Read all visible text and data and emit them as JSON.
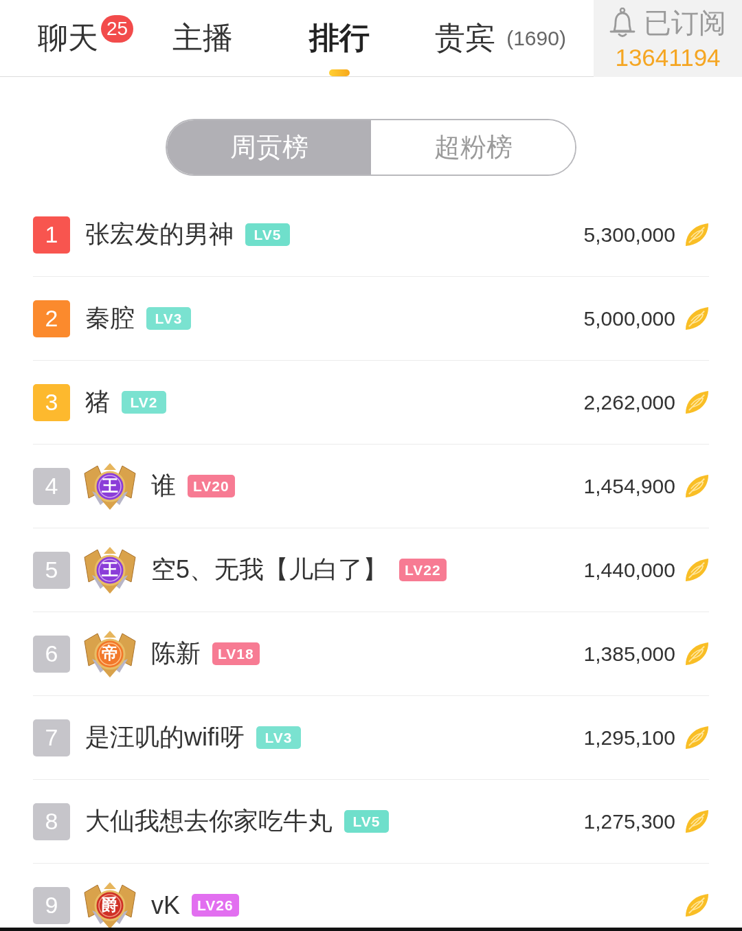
{
  "tabs": [
    {
      "label": "聊天",
      "selected": false,
      "badge": "25"
    },
    {
      "label": "主播",
      "selected": false
    },
    {
      "label": "排行",
      "selected": true
    },
    {
      "label": "贵宾",
      "selected": false,
      "count": "(1690)"
    }
  ],
  "subscribe": {
    "label": "已订阅",
    "count": "13641194"
  },
  "board_tabs": [
    {
      "label": "周贡榜",
      "selected": true
    },
    {
      "label": "超粉榜",
      "selected": false
    }
  ],
  "rows": [
    {
      "rank": {
        "text": "1",
        "color": "#f8554f"
      },
      "name": "张宏发的男神",
      "level": {
        "text": "LV5",
        "color": "#6fdfcb"
      },
      "amount": "5,300,000"
    },
    {
      "rank": {
        "text": "2",
        "color": "#fb8a2d"
      },
      "name": "秦腔",
      "level": {
        "text": "LV3",
        "color": "#7ae2d0"
      },
      "amount": "5,000,000"
    },
    {
      "rank": {
        "text": "3",
        "color": "#fdb92e"
      },
      "name": "猪",
      "level": {
        "text": "LV2",
        "color": "#7ae2d0"
      },
      "amount": "2,262,000"
    },
    {
      "rank": {
        "text": "4",
        "color": "#c6c5ca"
      },
      "emblem": {
        "kind": "violet",
        "label": "王"
      },
      "name": "谁",
      "level": {
        "text": "LV20",
        "color": "#f77b93"
      },
      "amount": "1,454,900"
    },
    {
      "rank": {
        "text": "5",
        "color": "#c6c5ca"
      },
      "emblem": {
        "kind": "violet",
        "label": "王"
      },
      "name": "空5、无我【儿白了】",
      "level": {
        "text": "LV22",
        "color": "#f77b93"
      },
      "amount": "1,440,000"
    },
    {
      "rank": {
        "text": "6",
        "color": "#c6c5ca"
      },
      "emblem": {
        "kind": "amber",
        "label": "帝"
      },
      "name": "陈新",
      "level": {
        "text": "LV18",
        "color": "#f77b93"
      },
      "amount": "1,385,000"
    },
    {
      "rank": {
        "text": "7",
        "color": "#c6c5ca"
      },
      "name": "是汪叽的wifi呀",
      "level": {
        "text": "LV3",
        "color": "#7ae2d0"
      },
      "amount": "1,295,100"
    },
    {
      "rank": {
        "text": "8",
        "color": "#c6c5ca"
      },
      "name": "大仙我想去你家吃牛丸",
      "level": {
        "text": "LV5",
        "color": "#6fdfcb"
      },
      "amount": "1,275,300"
    },
    {
      "rank": {
        "text": "9",
        "color": "#c6c5ca"
      },
      "emblem": {
        "kind": "crimson",
        "label": "爵"
      },
      "name": "vK",
      "level": {
        "text": "LV26",
        "color": "#e26ff0"
      }
    }
  ]
}
